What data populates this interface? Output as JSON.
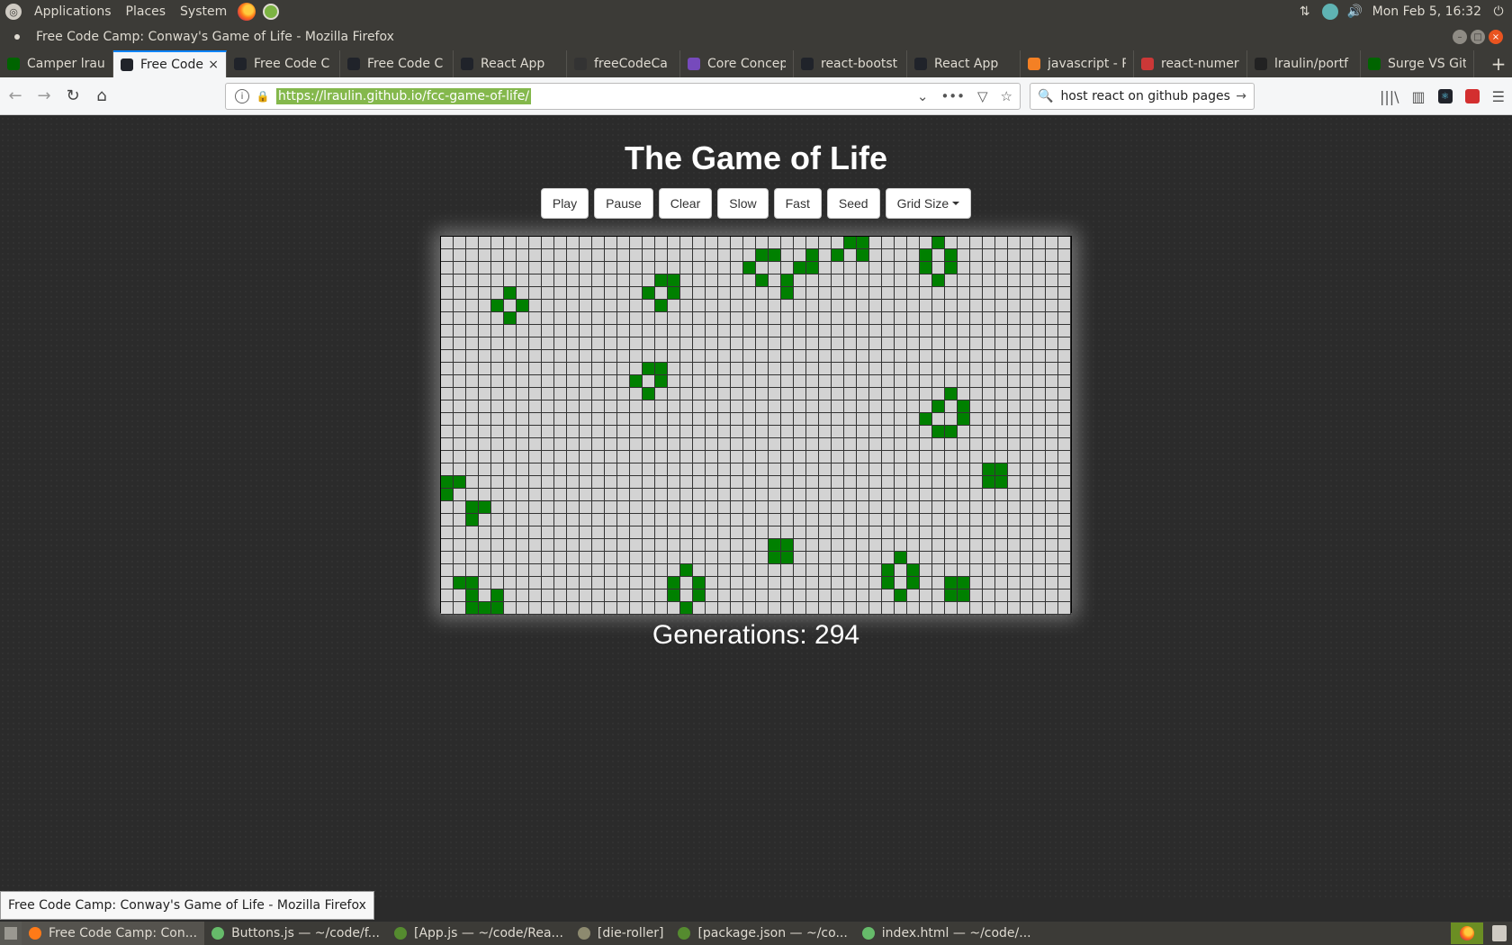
{
  "system_panel": {
    "menus": [
      "Applications",
      "Places",
      "System"
    ],
    "clock": "Mon Feb  5, 16:32"
  },
  "window": {
    "title": "Free Code Camp: Conway's Game of Life - Mozilla Firefox"
  },
  "tabs": [
    {
      "label": "Camper lrau",
      "favicon": "fcc-icon",
      "color": "#006400"
    },
    {
      "label": "Free Code",
      "favicon": "react-icon",
      "color": "#20232a",
      "active": true
    },
    {
      "label": "Free Code C",
      "favicon": "react-icon",
      "color": "#20232a"
    },
    {
      "label": "Free Code C",
      "favicon": "react-icon",
      "color": "#20232a"
    },
    {
      "label": "React App",
      "favicon": "react-icon",
      "color": "#20232a"
    },
    {
      "label": "freeCodeCa",
      "favicon": "fcc-icon",
      "color": "#333333"
    },
    {
      "label": "Core Concep",
      "favicon": "redux-icon",
      "color": "#764abc"
    },
    {
      "label": "react-bootst",
      "favicon": "react-icon",
      "color": "#20232a"
    },
    {
      "label": "React App",
      "favicon": "react-icon",
      "color": "#20232a"
    },
    {
      "label": "javascript - R",
      "favicon": "stackoverflow-icon",
      "color": "#f48024"
    },
    {
      "label": "react-numer",
      "favicon": "npm-icon",
      "color": "#cb3837"
    },
    {
      "label": "lraulin/portf",
      "favicon": "github-icon",
      "color": "#222222"
    },
    {
      "label": "Surge VS Git",
      "favicon": "fcc-icon",
      "color": "#006400"
    }
  ],
  "navbar": {
    "url": "https://lraulin.github.io/fcc-game-of-life/",
    "search_text": "host react on github pages"
  },
  "page": {
    "title": "The Game of Life",
    "buttons": [
      "Play",
      "Pause",
      "Clear",
      "Slow",
      "Fast",
      "Seed"
    ],
    "grid_size_label": "Grid Size",
    "generations_label": "Generations: 294",
    "grid": {
      "cols": 50,
      "rows": 30,
      "alive_color": "#008000",
      "dead_color": "#d3d3d3",
      "alive": [
        [
          0,
          32
        ],
        [
          0,
          33
        ],
        [
          0,
          39
        ],
        [
          1,
          25
        ],
        [
          1,
          26
        ],
        [
          1,
          29
        ],
        [
          1,
          31
        ],
        [
          1,
          33
        ],
        [
          1,
          38
        ],
        [
          1,
          40
        ],
        [
          2,
          24
        ],
        [
          2,
          28
        ],
        [
          2,
          29
        ],
        [
          2,
          38
        ],
        [
          2,
          40
        ],
        [
          3,
          17
        ],
        [
          3,
          18
        ],
        [
          3,
          25
        ],
        [
          3,
          27
        ],
        [
          3,
          39
        ],
        [
          4,
          5
        ],
        [
          4,
          16
        ],
        [
          4,
          18
        ],
        [
          4,
          27
        ],
        [
          5,
          4
        ],
        [
          5,
          6
        ],
        [
          5,
          17
        ],
        [
          6,
          5
        ],
        [
          10,
          16
        ],
        [
          10,
          17
        ],
        [
          11,
          15
        ],
        [
          11,
          17
        ],
        [
          12,
          16
        ],
        [
          12,
          40
        ],
        [
          13,
          39
        ],
        [
          13,
          41
        ],
        [
          14,
          38
        ],
        [
          14,
          41
        ],
        [
          15,
          39
        ],
        [
          15,
          40
        ],
        [
          18,
          43
        ],
        [
          18,
          44
        ],
        [
          19,
          0
        ],
        [
          19,
          1
        ],
        [
          19,
          43
        ],
        [
          19,
          44
        ],
        [
          20,
          0
        ],
        [
          21,
          2
        ],
        [
          21,
          3
        ],
        [
          22,
          2
        ],
        [
          24,
          26
        ],
        [
          24,
          27
        ],
        [
          25,
          26
        ],
        [
          25,
          27
        ],
        [
          25,
          36
        ],
        [
          26,
          19
        ],
        [
          26,
          35
        ],
        [
          26,
          37
        ],
        [
          27,
          1
        ],
        [
          27,
          2
        ],
        [
          27,
          18
        ],
        [
          27,
          20
        ],
        [
          27,
          35
        ],
        [
          27,
          37
        ],
        [
          27,
          40
        ],
        [
          27,
          41
        ],
        [
          28,
          2
        ],
        [
          28,
          4
        ],
        [
          28,
          18
        ],
        [
          28,
          20
        ],
        [
          28,
          36
        ],
        [
          28,
          40
        ],
        [
          28,
          41
        ],
        [
          29,
          2
        ],
        [
          29,
          3
        ],
        [
          29,
          4
        ],
        [
          29,
          19
        ]
      ]
    }
  },
  "tooltip": "Free Code Camp: Conway's Game of Life - Mozilla Firefox",
  "taskbar": [
    {
      "label": "Free Code Camp: Con...",
      "icon": "firefox-icon",
      "color": "#ff7a18"
    },
    {
      "label": "Buttons.js — ~/code/f...",
      "icon": "atom-icon",
      "color": "#66bb6a"
    },
    {
      "label": "[App.js — ~/code/Rea...",
      "icon": "atom-icon",
      "color": "#558b2f"
    },
    {
      "label": "[die-roller]",
      "icon": "folder-icon",
      "color": "#8d8a6f"
    },
    {
      "label": "[package.json — ~/co...",
      "icon": "atom-icon",
      "color": "#558b2f"
    },
    {
      "label": "index.html — ~/code/...",
      "icon": "atom-icon",
      "color": "#66bb6a"
    }
  ]
}
